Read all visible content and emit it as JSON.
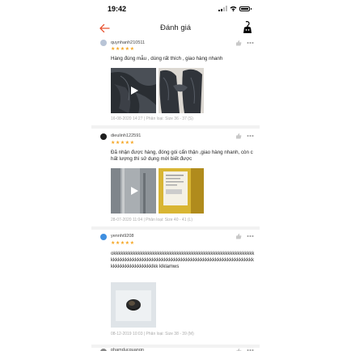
{
  "status": {
    "time": "19:42"
  },
  "header": {
    "title": "Đánh giá"
  },
  "reviews": [
    {
      "username": "quynhanh210511",
      "stars": 5,
      "text": "Hàng đúng mẫu , dùng rất thích , giao hàng nhanh",
      "meta": "16-08-2020 14:27 | Phân loại: Size 36 - 37 (S)"
    },
    {
      "username": "dieulinh122591",
      "stars": 5,
      "text": "Đã nhận được hàng, đóng gói cẩn thận ,giao hàng nhanh, còn chất lượng thì sử dụng mới biết được",
      "meta": "28-07-2020 11:04 | Phân loại: Size 40 - 41 (L)"
    },
    {
      "username": "yennhi9208",
      "stars": 5,
      "text": "okkkkkkkkkkkkkkkkkkkkkkkkkkkkkkkkkkkkkkkkkkkkkkkkkkkkkkkkkkkkkkkkkkkkkkkkkkkkkkkkkkkkkkkkkkkkkkkkkkkkkkkkkkkkkkkkkkkkkkkkkkkkkkkkkkkkkklkk klklamws",
      "meta": "08-12-2019 10:03 | Phân loại: Size 38 - 39 (M)"
    },
    {
      "username": "phamducquangn"
    }
  ]
}
